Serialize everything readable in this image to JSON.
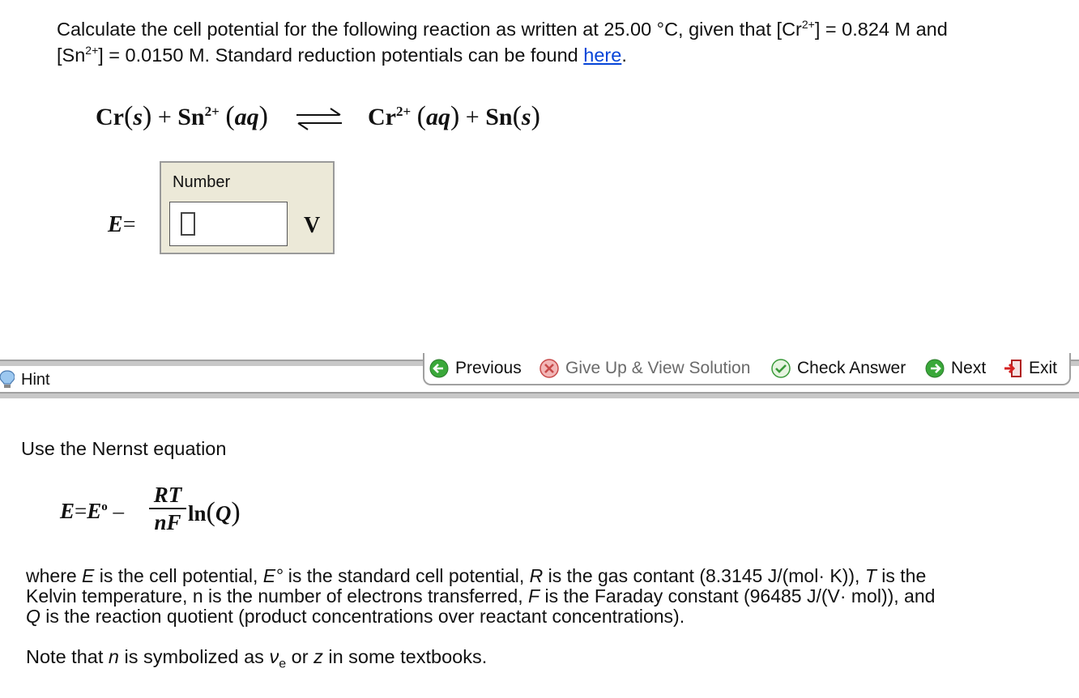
{
  "question": {
    "part1": "Calculate the cell potential for the following reaction as written at 25.00 °C, given that [Cr",
    "sup1": "2+",
    "part2": "] = 0.824 M and",
    "part3": "[Sn",
    "sup2": "2+",
    "part4": "] = 0.0150 M. Standard reduction potentials can be found ",
    "link": "here",
    "part5": "."
  },
  "reaction": {
    "r1": "Cr",
    "r1_state": "s",
    "plus": "+",
    "r2": "Sn",
    "r2_charge": "2+",
    "r2_state": "aq",
    "p1": "Cr",
    "p1_charge": "2+",
    "p1_state": "aq",
    "p2": "Sn",
    "p2_state": "s"
  },
  "answer": {
    "var": "E",
    "eq": "=",
    "label": "Number",
    "value": "",
    "unit": "V"
  },
  "toolbar": {
    "previous": "Previous",
    "give_up": "Give Up & View Solution",
    "check": "Check Answer",
    "next": "Next",
    "exit": "Exit"
  },
  "hint": {
    "label": "Hint",
    "intro": "Use the Nernst equation",
    "eq_left": "E",
    "eq_eq": "=",
    "eq_e0": "E",
    "eq_deg": "o",
    "eq_minus": "–",
    "frac_num": "RT",
    "frac_den": "nF",
    "ln": "ln",
    "Q": "Q",
    "d1": "where ",
    "d_E": "E",
    "d2": " is the cell potential, ",
    "d_E0": "E°",
    "d3": " is the standard cell potential, ",
    "d_R": "R",
    "d4": " is the gas contant (8.3145 J/(mol· K)), ",
    "d_T": "T",
    "d5": " is the",
    "d6": "Kelvin temperature, n is the number of electrons transferred, ",
    "d_F": "F",
    "d7": " is the Faraday constant (96485 J/(V· mol)), and",
    "d_Q": "Q",
    "d8": " is the reaction quotient (product concentrations over reactant concentrations).",
    "n1": "Note that ",
    "n_n": "n",
    "n2": " is symbolized as ",
    "n_nu": "ν",
    "n_sub": "e",
    "n3": " or ",
    "n_z": "z",
    "n4": " in some textbooks."
  },
  "colors": {
    "link": "#0645d8",
    "panel": "#ece9d8",
    "bar": "#c8c8c8"
  }
}
